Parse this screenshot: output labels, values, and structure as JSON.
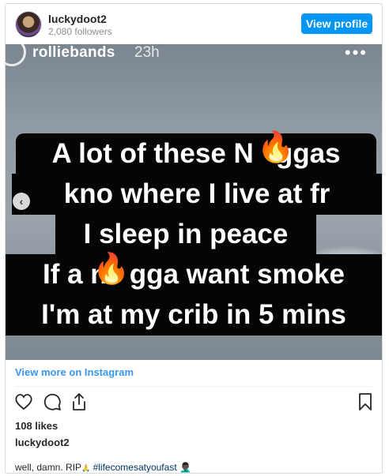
{
  "header": {
    "username": "luckydoot2",
    "followers": "2,080 followers",
    "view_profile": "View profile"
  },
  "story": {
    "username": "rolliebands",
    "time": "23h",
    "more": "•••",
    "prev_arrow": "‹",
    "lines": [
      "A lot of these N",
      "ggas",
      "kno where I live at fr",
      "I sleep in peace",
      "If a n",
      "gga want smoke",
      "I'm at my crib in 5 mins"
    ],
    "flame_emoji": "🔥"
  },
  "footer": {
    "view_more": "View more on Instagram",
    "likes": "108 likes",
    "caption_username": "luckydoot2",
    "caption_text": "well, damn. RIP",
    "caption_hashtag": "#lifecomesatyoufast",
    "caption_emoji_pray": "🙏",
    "caption_emoji_end": "🤦🏿‍♂️"
  },
  "icons": [
    "heart-icon",
    "comment-icon",
    "share-icon",
    "bookmark-icon"
  ],
  "colors": {
    "accent": "#0095f6",
    "link": "#3897f0",
    "hashtag": "#003569"
  }
}
